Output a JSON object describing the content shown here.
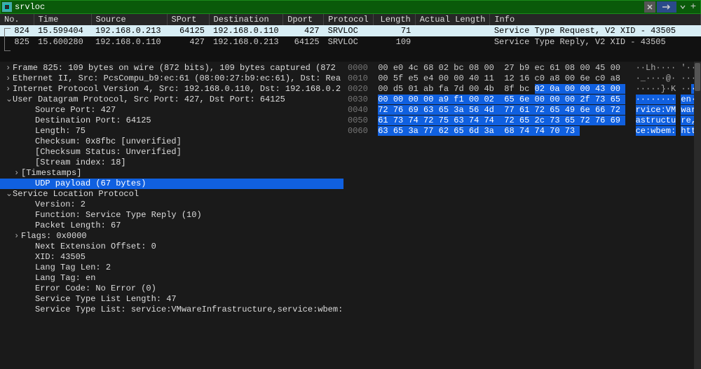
{
  "filter": {
    "value": "srvloc"
  },
  "columns": [
    "No.",
    "Time",
    "Source",
    "SPort",
    "Destination",
    "Dport",
    "Protocol",
    "Length",
    "Actual Length",
    "Info"
  ],
  "rows": [
    {
      "no": "824",
      "time": "15.599404",
      "src": "192.168.0.213",
      "sport": "64125",
      "dst": "192.168.0.110",
      "dport": "427",
      "proto": "SRVLOC",
      "len": "71",
      "alen": "",
      "info": "Service Type Request, V2 XID - 43505",
      "selected": true
    },
    {
      "no": "825",
      "time": "15.600280",
      "src": "192.168.0.110",
      "sport": "427",
      "dst": "192.168.0.213",
      "dport": "64125",
      "proto": "SRVLOC",
      "len": "109",
      "alen": "",
      "info": "Service Type Reply, V2 XID - 43505",
      "selected": false
    }
  ],
  "tree": [
    {
      "lvl": 0,
      "tog": ">",
      "hl": false,
      "text": "Frame 825: 109 bytes on wire (872 bits), 109 bytes captured (872"
    },
    {
      "lvl": 0,
      "tog": ">",
      "hl": false,
      "text": "Ethernet II, Src: PcsCompu_b9:ec:61 (08:00:27:b9:ec:61), Dst: Rea"
    },
    {
      "lvl": 0,
      "tog": ">",
      "hl": false,
      "text": "Internet Protocol Version 4, Src: 192.168.0.110, Dst: 192.168.0.2"
    },
    {
      "lvl": 0,
      "tog": "v",
      "hl": false,
      "text": "User Datagram Protocol, Src Port: 427, Dst Port: 64125"
    },
    {
      "lvl": 2,
      "tog": "",
      "hl": false,
      "text": "Source Port: 427"
    },
    {
      "lvl": 2,
      "tog": "",
      "hl": false,
      "text": "Destination Port: 64125"
    },
    {
      "lvl": 2,
      "tog": "",
      "hl": false,
      "text": "Length: 75"
    },
    {
      "lvl": 2,
      "tog": "",
      "hl": false,
      "text": "Checksum: 0x8fbc [unverified]"
    },
    {
      "lvl": 2,
      "tog": "",
      "hl": false,
      "text": "[Checksum Status: Unverified]"
    },
    {
      "lvl": 2,
      "tog": "",
      "hl": false,
      "text": "[Stream index: 18]"
    },
    {
      "lvl": 1,
      "tog": ">",
      "hl": false,
      "text": "[Timestamps]"
    },
    {
      "lvl": 2,
      "tog": "",
      "hl": true,
      "text": "UDP payload (67 bytes)"
    },
    {
      "lvl": 0,
      "tog": "v",
      "hl": false,
      "text": "Service Location Protocol"
    },
    {
      "lvl": 2,
      "tog": "",
      "hl": false,
      "text": "Version: 2"
    },
    {
      "lvl": 2,
      "tog": "",
      "hl": false,
      "text": "Function: Service Type Reply (10)"
    },
    {
      "lvl": 2,
      "tog": "",
      "hl": false,
      "text": "Packet Length: 67"
    },
    {
      "lvl": 1,
      "tog": ">",
      "hl": false,
      "text": "Flags: 0x0000"
    },
    {
      "lvl": 2,
      "tog": "",
      "hl": false,
      "text": "Next Extension Offset: 0"
    },
    {
      "lvl": 2,
      "tog": "",
      "hl": false,
      "text": "XID: 43505"
    },
    {
      "lvl": 2,
      "tog": "",
      "hl": false,
      "text": "Lang Tag Len: 2"
    },
    {
      "lvl": 2,
      "tog": "",
      "hl": false,
      "text": "Lang Tag: en"
    },
    {
      "lvl": 2,
      "tog": "",
      "hl": false,
      "text": "Error Code: No Error (0)"
    },
    {
      "lvl": 2,
      "tog": "",
      "hl": false,
      "text": "Service Type List Length: 47"
    },
    {
      "lvl": 2,
      "tog": "",
      "hl": false,
      "text": "Service Type List: service:VMwareInfrastructure,service:wbem:h"
    }
  ],
  "hex": {
    "selStart": 42,
    "selEnd": 109,
    "lines": [
      {
        "off": "0000",
        "b": "00 e0 4c 68 02 bc 08 00 27 b9 ec 61 08 00 45 00",
        "a": "··Lh···· '··a··E·"
      },
      {
        "off": "0010",
        "b": "00 5f e5 e4 00 00 40 11 12 16 c0 a8 00 6e c0 a8",
        "a": "·_····@· ·····n··"
      },
      {
        "off": "0020",
        "b": "00 d5 01 ab fa 7d 00 4b 8f bc 02 0a 00 00 43 00",
        "a": "·····}·K ······C·"
      },
      {
        "off": "0030",
        "b": "00 00 00 00 a9 f1 00 02 65 6e 00 00 00 2f 73 65",
        "a": "········ en···/se"
      },
      {
        "off": "0040",
        "b": "72 76 69 63 65 3a 56 4d 77 61 72 65 49 6e 66 72",
        "a": "rvice:VM wareInfr"
      },
      {
        "off": "0050",
        "b": "61 73 74 72 75 63 74 74 72 65 2c 73 65 72 76 69",
        "a": "astructu re,servi"
      },
      {
        "off": "0060",
        "b": "63 65 3a 77 62 65 6d 3a 68 74 74 70 73",
        "a": "ce:wbem: https"
      }
    ]
  }
}
